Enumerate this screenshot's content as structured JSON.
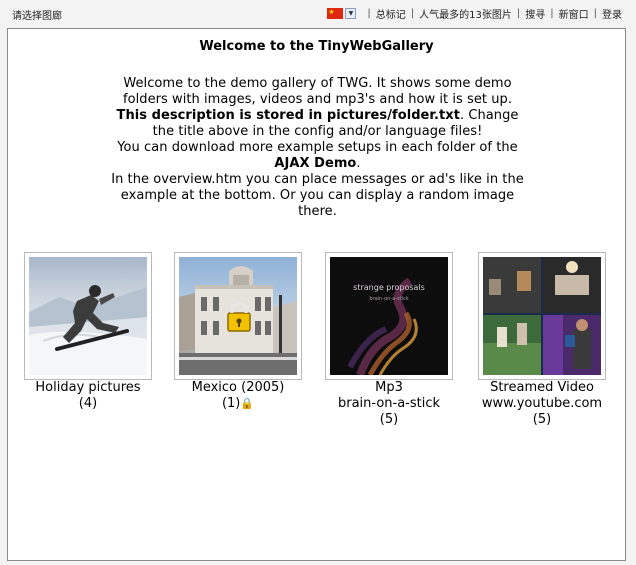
{
  "topbar": {
    "gallery_select": "请选择图廊",
    "links": [
      "总标记",
      "人气最多的13张图片",
      "搜寻",
      "新窗口",
      "登录"
    ]
  },
  "main": {
    "title": "Welcome to the TinyWebGallery",
    "desc": {
      "p1": "Welcome to the demo gallery of TWG. It shows some demo folders with images, videos and mp3's and how it is set up.",
      "p2_bold": "This description is stored in pictures/folder.txt",
      "p2_rest": ". Change the title above in the config and/or language files!",
      "p3": "You can download more example setups in each folder of the",
      "p3_bold": "AJAX Demo",
      "p3_end": ".",
      "p4": "In the overview.htm you can place messages or ad's like in the example at the bottom. Or you can display a random image there."
    }
  },
  "folders": [
    {
      "line1": "Holiday pictures",
      "line2": "(4)"
    },
    {
      "line1": "Mexico (2005)",
      "line2": "(1)"
    },
    {
      "line1": "Mp3",
      "line2": "brain-on-a-stick",
      "line3": "(5)"
    },
    {
      "line1": "Streamed Video",
      "line2": "www.youtube.com",
      "line3": "(5)"
    }
  ],
  "mp3_cover": {
    "title": "strange proposals",
    "subtitle": "brain-on-a-stick"
  },
  "colors": {
    "frame_border": "#8a8a8a",
    "background": "#f3f3f3",
    "panel": "#ffffff"
  }
}
